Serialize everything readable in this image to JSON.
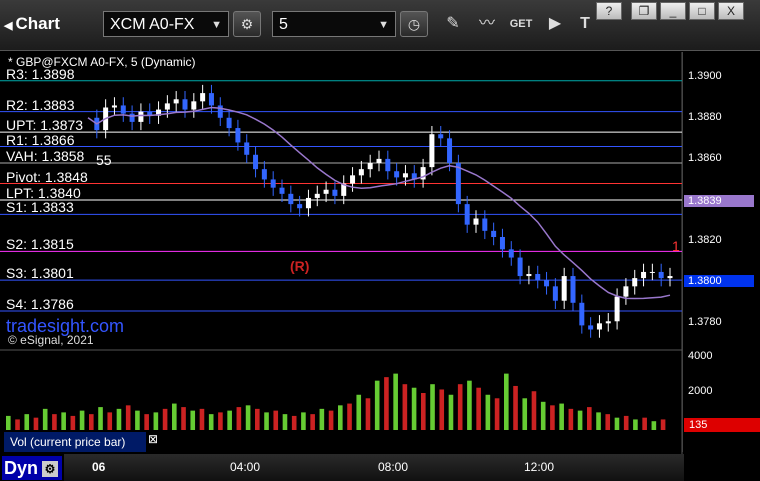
{
  "toolbar": {
    "title": "Chart",
    "symbol": "XCM A0-FX",
    "interval": "5",
    "window_buttons": [
      "?",
      "❐",
      "_",
      "□",
      "X"
    ]
  },
  "chart_data": {
    "type": "candlestick",
    "title": "* GBP@FXCM A0-FX, 5 (Dynamic)",
    "ylim": [
      1.3768,
      1.3912
    ],
    "y_ticks": [
      "1.3900",
      "1.3880",
      "1.3860",
      "1.3839",
      "1.3820",
      "1.3800",
      "1.3780"
    ],
    "current_price_label": "1.3800",
    "ma_label": "1.3839",
    "x_ticks": [
      "06",
      "04:00",
      "08:00",
      "12:00"
    ],
    "levels": [
      {
        "name": "R3",
        "label": "R3: 1.3898",
        "value": 1.3898,
        "color": "#00aaaa"
      },
      {
        "name": "R2",
        "label": "R2: 1.3883",
        "value": 1.3883,
        "color": "#3355ff"
      },
      {
        "name": "UPT",
        "label": "UPT: 1.3873",
        "value": 1.3873,
        "color": "#ffffff"
      },
      {
        "name": "R1",
        "label": "R1: 1.3866",
        "value": 1.3866,
        "color": "#3355ff"
      },
      {
        "name": "VAH",
        "label": "VAH: 1.3858",
        "value": 1.3858,
        "color": "#aaaaaa"
      },
      {
        "name": "Pivot",
        "label": "Pivot: 1.3848",
        "value": 1.3848,
        "color": "#ff3333"
      },
      {
        "name": "LPT",
        "label": "LPT: 1.3840",
        "value": 1.384,
        "color": "#ffffff"
      },
      {
        "name": "S1",
        "label": "S1: 1.3833",
        "value": 1.3833,
        "color": "#3355ff"
      },
      {
        "name": "S2",
        "label": "S2: 1.3815",
        "value": 1.3815,
        "color": "#ff33ff"
      },
      {
        "name": "S3",
        "label": "S3: 1.3801",
        "value": 1.3801,
        "color": "#3355ff"
      },
      {
        "name": "S4",
        "label": "S4: 1.3786",
        "value": 1.3786,
        "color": "#3355ff"
      }
    ],
    "close_series": [
      1.388,
      1.3874,
      1.3885,
      1.3886,
      1.3882,
      1.3878,
      1.3883,
      1.3881,
      1.3884,
      1.3887,
      1.3889,
      1.3884,
      1.3888,
      1.3892,
      1.3886,
      1.388,
      1.3875,
      1.3868,
      1.3862,
      1.3855,
      1.385,
      1.3846,
      1.3843,
      1.3838,
      1.3836,
      1.3841,
      1.3843,
      1.3845,
      1.3842,
      1.3848,
      1.3852,
      1.3855,
      1.3858,
      1.386,
      1.3854,
      1.3851,
      1.3853,
      1.385,
      1.3856,
      1.3872,
      1.387,
      1.3858,
      1.3838,
      1.3828,
      1.3831,
      1.3825,
      1.3822,
      1.3816,
      1.3812,
      1.3803,
      1.3804,
      1.3801,
      1.3798,
      1.3791,
      1.3803,
      1.379,
      1.3779,
      1.3777,
      1.378,
      1.3781,
      1.3793,
      1.3798,
      1.3802,
      1.3805,
      1.3805,
      1.3802,
      1.3803
    ],
    "annotations": {
      "r_marker": "(R)",
      "left_note": "55",
      "s2_marker": "1"
    }
  },
  "branding": {
    "site": "tradesight.com",
    "copyright": "© eSignal, 2021"
  },
  "volume": {
    "label": "Vol (current price bar)",
    "y_ticks": [
      "4000",
      "2000"
    ],
    "current": "135",
    "values": [
      800,
      600,
      900,
      700,
      1200,
      900,
      1000,
      800,
      1100,
      900,
      1300,
      1000,
      1200,
      1400,
      1100,
      900,
      1000,
      1200,
      1500,
      1300,
      1100,
      1200,
      900,
      1000,
      1100,
      1300,
      1400,
      1200,
      1000,
      1100,
      900,
      800,
      1000,
      900,
      1200,
      1100,
      1400,
      1500,
      2000,
      1800,
      2800,
      3000,
      3200,
      2600,
      2400,
      2100,
      2600,
      2300,
      2000,
      2600,
      2800,
      2400,
      2000,
      1800,
      3200,
      2500,
      1800,
      2200,
      1600,
      1400,
      1500,
      1200,
      1100,
      1300,
      1000,
      900,
      700,
      800,
      600,
      700,
      500,
      600
    ]
  },
  "bottom": {
    "workspace": "Dyn",
    "workspace_icon": "gear-icon"
  }
}
